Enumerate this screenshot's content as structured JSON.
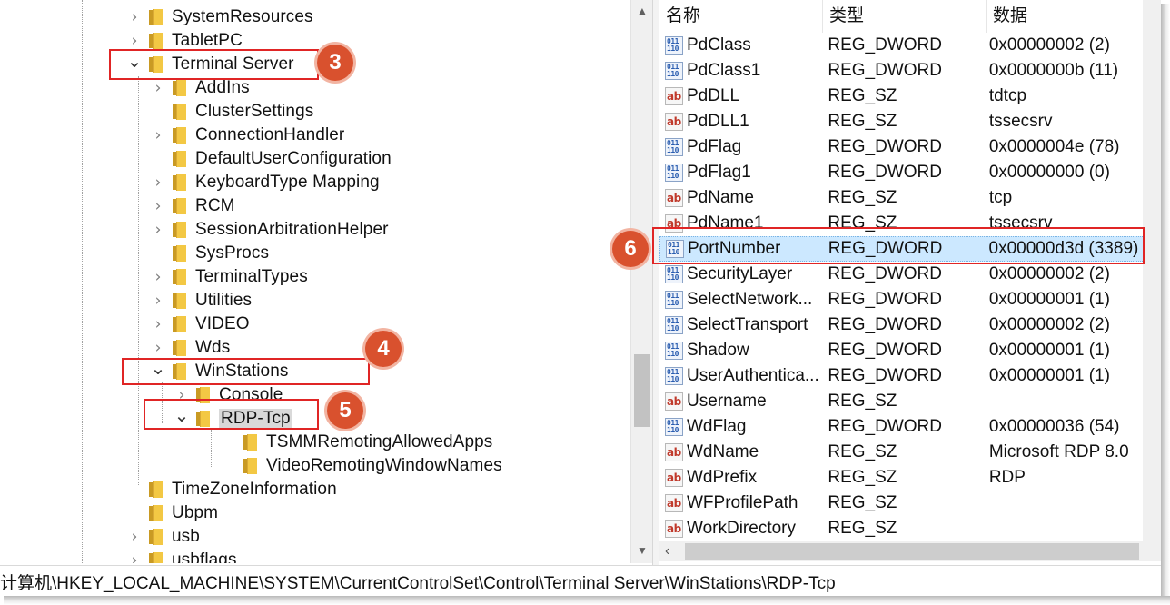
{
  "tree": {
    "items": [
      {
        "label": "SystemResources",
        "expander": "collapsed"
      },
      {
        "label": "TabletPC",
        "expander": "collapsed"
      },
      {
        "label": "Terminal Server",
        "expander": "expanded"
      },
      {
        "label": "AddIns",
        "expander": "collapsed"
      },
      {
        "label": "ClusterSettings",
        "expander": "none"
      },
      {
        "label": "ConnectionHandler",
        "expander": "collapsed"
      },
      {
        "label": "DefaultUserConfiguration",
        "expander": "none"
      },
      {
        "label": "KeyboardType Mapping",
        "expander": "collapsed"
      },
      {
        "label": "RCM",
        "expander": "collapsed"
      },
      {
        "label": "SessionArbitrationHelper",
        "expander": "collapsed"
      },
      {
        "label": "SysProcs",
        "expander": "none"
      },
      {
        "label": "TerminalTypes",
        "expander": "collapsed"
      },
      {
        "label": "Utilities",
        "expander": "collapsed"
      },
      {
        "label": "VIDEO",
        "expander": "collapsed"
      },
      {
        "label": "Wds",
        "expander": "collapsed"
      },
      {
        "label": "WinStations",
        "expander": "expanded"
      },
      {
        "label": "Console",
        "expander": "collapsed"
      },
      {
        "label": "RDP-Tcp",
        "expander": "expanded",
        "selected": true
      },
      {
        "label": "TSMMRemotingAllowedApps",
        "expander": "none"
      },
      {
        "label": "VideoRemotingWindowNames",
        "expander": "none"
      },
      {
        "label": "TimeZoneInformation",
        "expander": "none"
      },
      {
        "label": "Ubpm",
        "expander": "none"
      },
      {
        "label": "usb",
        "expander": "collapsed"
      },
      {
        "label": "usbflags",
        "expander": "collapsed"
      }
    ]
  },
  "list": {
    "headers": {
      "name": "名称",
      "type": "类型",
      "data": "数据"
    },
    "rows": [
      {
        "name": "PdClass",
        "type": "REG_DWORD",
        "data": "0x00000002 (2)",
        "icon": "dword"
      },
      {
        "name": "PdClass1",
        "type": "REG_DWORD",
        "data": "0x0000000b (11)",
        "icon": "dword"
      },
      {
        "name": "PdDLL",
        "type": "REG_SZ",
        "data": "tdtcp",
        "icon": "sz"
      },
      {
        "name": "PdDLL1",
        "type": "REG_SZ",
        "data": "tssecsrv",
        "icon": "sz"
      },
      {
        "name": "PdFlag",
        "type": "REG_DWORD",
        "data": "0x0000004e (78)",
        "icon": "dword"
      },
      {
        "name": "PdFlag1",
        "type": "REG_DWORD",
        "data": "0x00000000 (0)",
        "icon": "dword"
      },
      {
        "name": "PdName",
        "type": "REG_SZ",
        "data": "tcp",
        "icon": "sz"
      },
      {
        "name": "PdName1",
        "type": "REG_SZ",
        "data": "tssecsrv",
        "icon": "sz"
      },
      {
        "name": "PortNumber",
        "type": "REG_DWORD",
        "data": "0x00000d3d (3389)",
        "icon": "dword",
        "selected": true
      },
      {
        "name": "SecurityLayer",
        "type": "REG_DWORD",
        "data": "0x00000002 (2)",
        "icon": "dword"
      },
      {
        "name": "SelectNetwork...",
        "type": "REG_DWORD",
        "data": "0x00000001 (1)",
        "icon": "dword"
      },
      {
        "name": "SelectTransport",
        "type": "REG_DWORD",
        "data": "0x00000002 (2)",
        "icon": "dword"
      },
      {
        "name": "Shadow",
        "type": "REG_DWORD",
        "data": "0x00000001 (1)",
        "icon": "dword"
      },
      {
        "name": "UserAuthentica...",
        "type": "REG_DWORD",
        "data": "0x00000001 (1)",
        "icon": "dword"
      },
      {
        "name": "Username",
        "type": "REG_SZ",
        "data": "",
        "icon": "sz"
      },
      {
        "name": "WdFlag",
        "type": "REG_DWORD",
        "data": "0x00000036 (54)",
        "icon": "dword"
      },
      {
        "name": "WdName",
        "type": "REG_SZ",
        "data": "Microsoft RDP 8.0",
        "icon": "sz"
      },
      {
        "name": "WdPrefix",
        "type": "REG_SZ",
        "data": "RDP",
        "icon": "sz"
      },
      {
        "name": "WFProfilePath",
        "type": "REG_SZ",
        "data": "",
        "icon": "sz"
      },
      {
        "name": "WorkDirectory",
        "type": "REG_SZ",
        "data": "",
        "icon": "sz"
      }
    ]
  },
  "icons": {
    "dword_glyph": "011\n110",
    "sz_glyph": "ab"
  },
  "status": {
    "path": "计算机\\HKEY_LOCAL_MACHINE\\SYSTEM\\CurrentControlSet\\Control\\Terminal Server\\WinStations\\RDP-Tcp"
  },
  "annotations": {
    "step3": "3",
    "step4": "4",
    "step5": "5",
    "step6": "6"
  },
  "colors": {
    "callout_border": "#e02525",
    "badge_fill": "#d9512e",
    "selection_blue": "#cce8ff"
  }
}
